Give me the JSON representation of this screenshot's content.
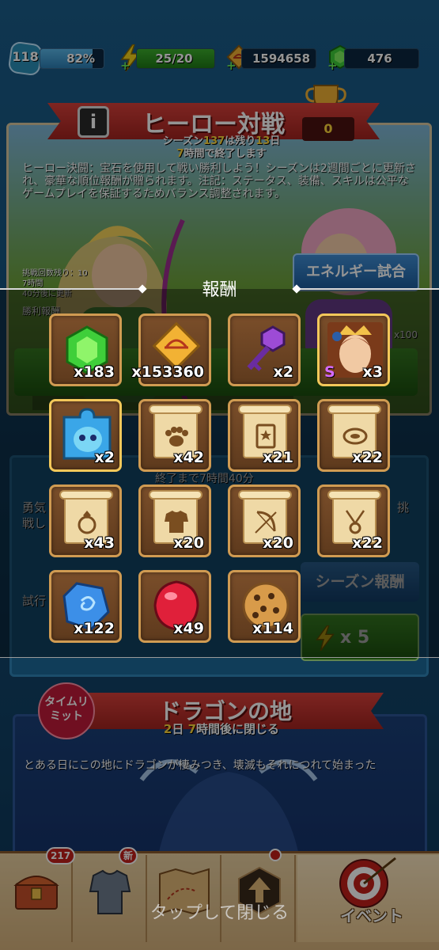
{
  "top_bar": {
    "level": "118",
    "xp_percent_label": "82%",
    "xp_fraction": 0.82,
    "energy": "25/20",
    "gold": "1594658",
    "gems": "476"
  },
  "hero_battle": {
    "title": "ヒーロー対戦",
    "info_label": "i",
    "season_prefix": "シーズン",
    "season_number": "137",
    "season_mid": "は残り",
    "season_days": "13",
    "season_day_unit": "日",
    "season_hours": "7",
    "season_end_text": "時間で終了します",
    "trophy_count": "0",
    "description": "ヒーロー決闘：宝石を使用して戦い勝利しよう！シーズンは2週間ごとに更新され、豪華な順位報酬が贈られます。注記：ステータス、装備、スキルは公平なゲームプレイを保証するためバランス調整されます。",
    "energy_match_button": "エネルギー試合",
    "stat_line1": "挑戦回数残り：10",
    "stat_line2": "7時間",
    "stat_line3": "40分後に更新",
    "win_reward_label": "勝利報酬",
    "right_count": "x100"
  },
  "middle_panel": {
    "season_reward_button": "シーズン報酬",
    "x5_label": "x 5",
    "left_text_1": "勇気",
    "left_text_2": "戦し",
    "right_text": "挑",
    "trial_label": "試行",
    "timer_text": "終了まで7時間40分"
  },
  "dragon_land": {
    "limited_label": "タイムリミット",
    "title": "ドラゴンの地",
    "days": "2",
    "day_unit": "日",
    "hours": "7",
    "close_text": "時間後に閉じる",
    "description": "とある日にこの地にドラゴンが棲みつき、壊滅もそれにつれて始まった"
  },
  "bottom_nav": {
    "chest_badge": "217",
    "armor_badge": "新",
    "event_label": "イベント"
  },
  "rewards_modal": {
    "title": "報酬",
    "close_hint": "タップして閉じる",
    "items": [
      {
        "icon": "green-gem-icon",
        "qty": "x183"
      },
      {
        "icon": "gold-coin-icon",
        "qty": "x153360"
      },
      {
        "icon": "purple-key-icon",
        "qty": "x2"
      },
      {
        "icon": "hero-portrait-icon",
        "qty": "x3",
        "tag": "S"
      },
      {
        "icon": "hero-puzzle-piece-icon",
        "qty": "x2"
      },
      {
        "icon": "paw-scroll-icon",
        "qty": "x42"
      },
      {
        "icon": "book-scroll-icon",
        "qty": "x21"
      },
      {
        "icon": "ring-band-scroll-icon",
        "qty": "x22"
      },
      {
        "icon": "ring-scroll-icon",
        "qty": "x43"
      },
      {
        "icon": "armor-scroll-icon",
        "qty": "x20"
      },
      {
        "icon": "bow-scroll-icon",
        "qty": "x20"
      },
      {
        "icon": "amulet-scroll-icon",
        "qty": "x22"
      },
      {
        "icon": "blue-crystal-icon",
        "qty": "x122"
      },
      {
        "icon": "red-gem-icon",
        "qty": "x49"
      },
      {
        "icon": "cookie-icon",
        "qty": "x114"
      }
    ]
  },
  "colors": {
    "gem_green": "#3fcf3a",
    "gold": "#f2b234",
    "banner_red": "#c9302b",
    "tile_border": "#d09b52"
  }
}
